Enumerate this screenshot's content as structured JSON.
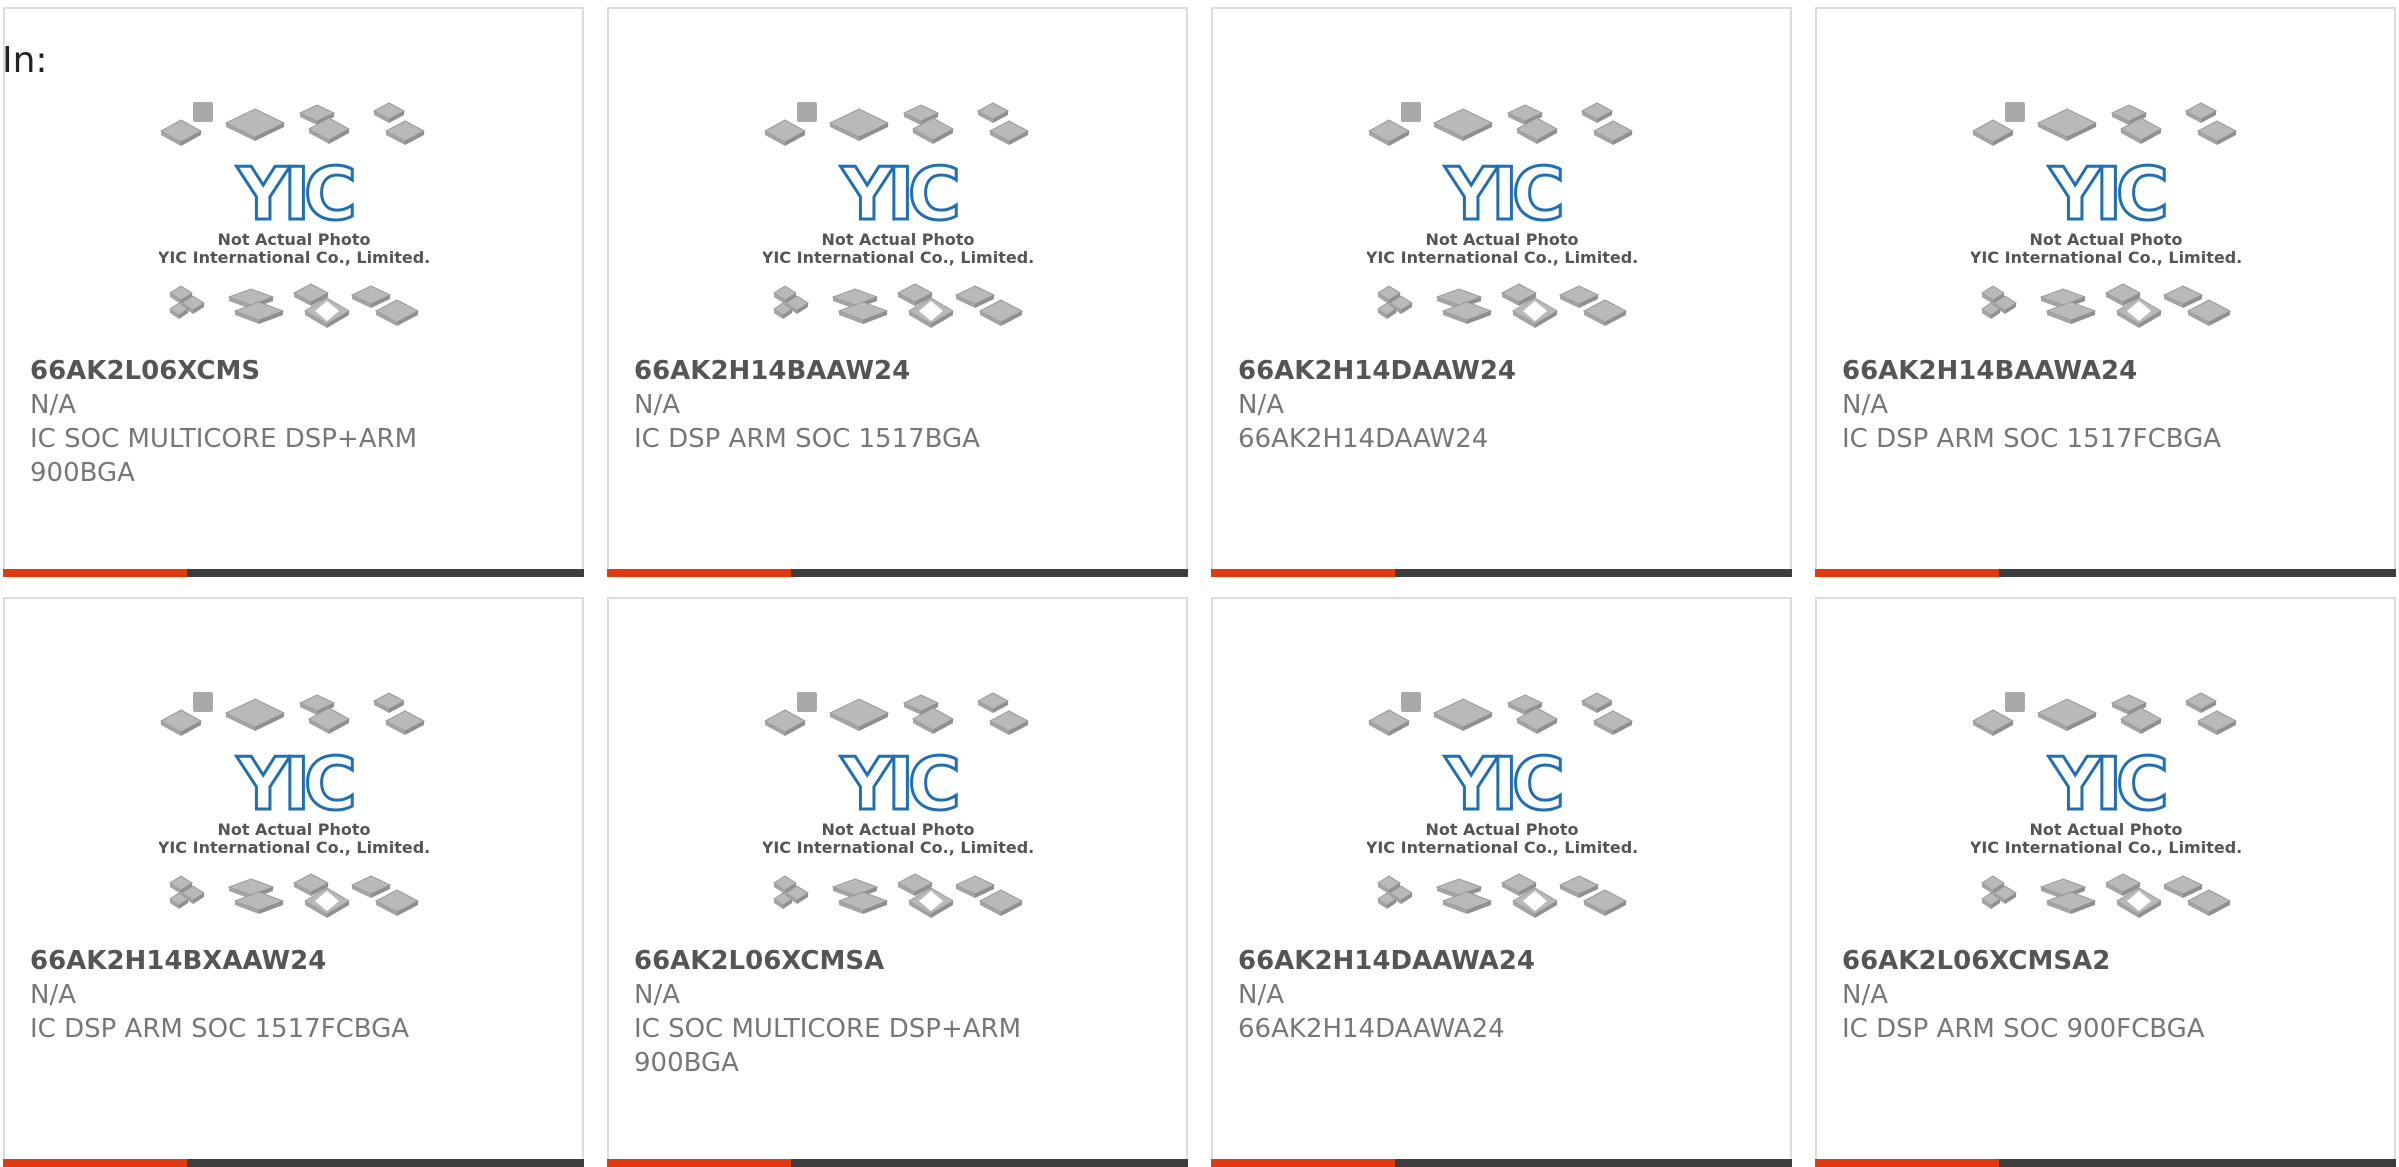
{
  "page": {
    "in_label": "In:"
  },
  "photo": {
    "caption_line1": "Not Actual Photo",
    "caption_line2": "YIC International Co., Limited.",
    "logo_text": "YIC"
  },
  "colors": {
    "accent": "#e03a10",
    "bar": "#3d3d3d",
    "logo_blue": "#1f6fb2",
    "border": "#dcdcdc"
  },
  "products": [
    {
      "part": "66AK2L06XCMS",
      "mfr": "N/A",
      "desc": "IC SOC MULTICORE DSP+ARM 900BGA"
    },
    {
      "part": "66AK2H14BAAW24",
      "mfr": "N/A",
      "desc": "IC DSP ARM SOC 1517BGA"
    },
    {
      "part": "66AK2H14DAAW24",
      "mfr": "N/A",
      "desc": "66AK2H14DAAW24"
    },
    {
      "part": "66AK2H14BAAWA24",
      "mfr": "N/A",
      "desc": "IC DSP ARM SOC 1517FCBGA"
    },
    {
      "part": "66AK2H14BXAAW24",
      "mfr": "N/A",
      "desc": "IC DSP ARM SOC 1517FCBGA"
    },
    {
      "part": "66AK2L06XCMSA",
      "mfr": "N/A",
      "desc": "IC SOC MULTICORE DSP+ARM 900BGA"
    },
    {
      "part": "66AK2H14DAAWA24",
      "mfr": "N/A",
      "desc": "66AK2H14DAAWA24"
    },
    {
      "part": "66AK2L06XCMSA2",
      "mfr": "N/A",
      "desc": "IC DSP ARM SOC 900FCBGA"
    }
  ]
}
